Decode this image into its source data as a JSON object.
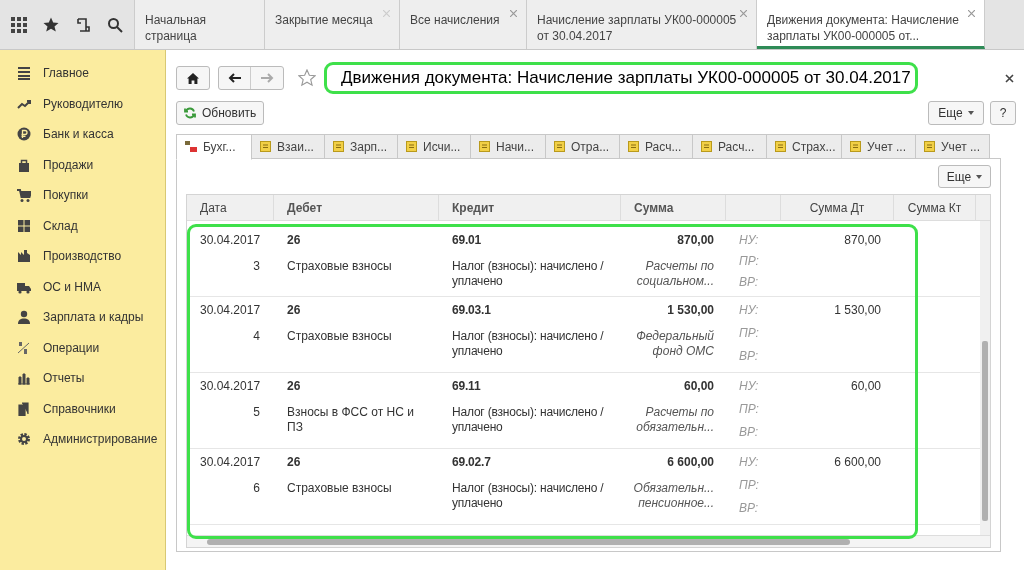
{
  "top_tabs": [
    {
      "label": "Начальная страница",
      "selected": false,
      "closable": false
    },
    {
      "label": "Закрытие месяца",
      "selected": false,
      "closable": true
    },
    {
      "label": "Все начисления",
      "selected": false,
      "closable": true
    },
    {
      "label": "Начисление зарплаты УК00-000005 от 30.04.2017",
      "selected": false,
      "closable": true
    },
    {
      "label": "Движения документа: Начисление зарплаты УК00-000005 от...",
      "selected": true,
      "closable": true
    }
  ],
  "sidebar": {
    "items": [
      {
        "label": "Главное"
      },
      {
        "label": "Руководителю"
      },
      {
        "label": "Банк и касса"
      },
      {
        "label": "Продажи"
      },
      {
        "label": "Покупки"
      },
      {
        "label": "Склад"
      },
      {
        "label": "Производство"
      },
      {
        "label": "ОС и НМА"
      },
      {
        "label": "Зарплата и кадры"
      },
      {
        "label": "Операции"
      },
      {
        "label": "Отчеты"
      },
      {
        "label": "Справочники"
      },
      {
        "label": "Администрирование"
      }
    ]
  },
  "title": "Движения документа: Начисление зарплаты УК00-000005 от 30.04.2017",
  "refresh_button": "Обновить",
  "more_button": "Еще",
  "help_button": "?",
  "doc_tabs": [
    {
      "label": "Бухг...",
      "selected": true,
      "kind": "accounting"
    },
    {
      "label": "Взаи...",
      "selected": false,
      "kind": "register"
    },
    {
      "label": "Зарп...",
      "selected": false,
      "kind": "register"
    },
    {
      "label": "Исчи...",
      "selected": false,
      "kind": "register"
    },
    {
      "label": "Начи...",
      "selected": false,
      "kind": "register"
    },
    {
      "label": "Отра...",
      "selected": false,
      "kind": "register"
    },
    {
      "label": "Расч...",
      "selected": false,
      "kind": "register"
    },
    {
      "label": "Расч...",
      "selected": false,
      "kind": "register"
    },
    {
      "label": "Страх...",
      "selected": false,
      "kind": "register"
    },
    {
      "label": "Учет ...",
      "selected": false,
      "kind": "register"
    },
    {
      "label": "Учет ...",
      "selected": false,
      "kind": "register"
    }
  ],
  "table_more_button": "Еще",
  "table": {
    "columns": [
      "Дата",
      "Дебет",
      "Кредит",
      "Сумма",
      "Сумма Дт",
      "Сумма Кт"
    ],
    "rows": [
      {
        "date": "30.04.2017",
        "number": "3",
        "debit": "26",
        "debit_subconto": "Страховые взносы",
        "credit": "69.01",
        "credit_subconto": "Налог (взносы): начислено / уплачено",
        "sum": "870,00",
        "content": "Расчеты по социальном...",
        "labels": [
          "НУ:",
          "ПР:",
          "ВР:"
        ],
        "sum_dt": "870,00"
      },
      {
        "date": "30.04.2017",
        "number": "4",
        "debit": "26",
        "debit_subconto": "Страховые взносы",
        "credit": "69.03.1",
        "credit_subconto": "Налог (взносы): начислено / уплачено",
        "sum": "1 530,00",
        "content": "Федеральный фонд ОМС",
        "labels": [
          "НУ:",
          "ПР:",
          "ВР:"
        ],
        "sum_dt": "1 530,00"
      },
      {
        "date": "30.04.2017",
        "number": "5",
        "debit": "26",
        "debit_subconto": "Взносы в ФСС от НС и ПЗ",
        "credit": "69.11",
        "credit_subconto": "Налог (взносы): начислено / уплачено",
        "sum": "60,00",
        "content": "Расчеты по обязательн...",
        "labels": [
          "НУ:",
          "ПР:",
          "ВР:"
        ],
        "sum_dt": "60,00"
      },
      {
        "date": "30.04.2017",
        "number": "6",
        "debit": "26",
        "debit_subconto": "Страховые взносы",
        "credit": "69.02.7",
        "credit_subconto": "Налог (взносы): начислено / уплачено",
        "sum": "6 600,00",
        "content": "Обязательн... пенсионное...",
        "labels": [
          "НУ:",
          "ПР:",
          "ВР:"
        ],
        "sum_dt": "6 600,00"
      }
    ]
  }
}
